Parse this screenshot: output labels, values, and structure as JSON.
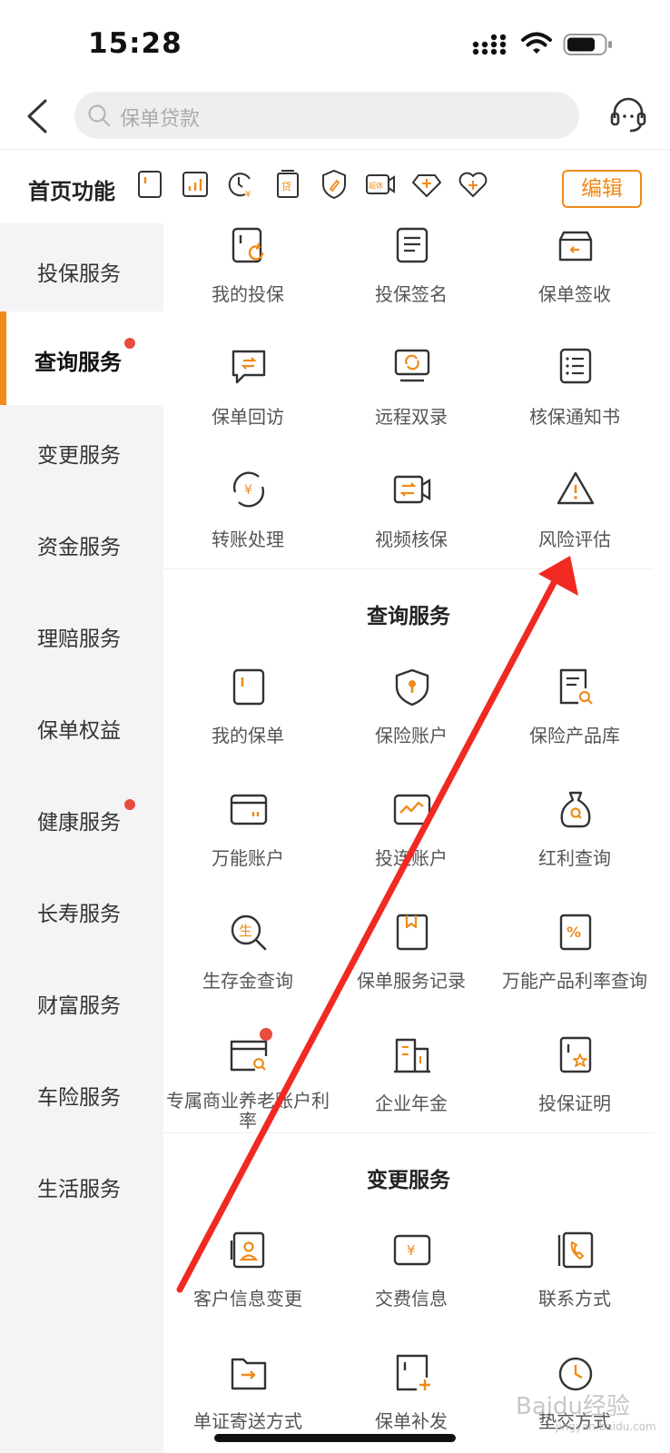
{
  "status_bar": {
    "time": "15:28"
  },
  "search": {
    "placeholder": "保单贷款"
  },
  "home_functions": {
    "title": "首页功能",
    "icons": [
      "policy-icon",
      "chart-icon",
      "clock-yuan-icon",
      "loan-doc-icon",
      "shield-pen-icon",
      "video-icon",
      "diamond-icon",
      "heart-icon"
    ],
    "loan_label": "贷",
    "video_label": "超体",
    "edit_label": "编辑"
  },
  "sidebar": {
    "items": [
      {
        "label": "投保服务",
        "active": false,
        "dot": false
      },
      {
        "label": "查询服务",
        "active": true,
        "dot": true
      },
      {
        "label": "变更服务",
        "active": false,
        "dot": false
      },
      {
        "label": "资金服务",
        "active": false,
        "dot": false
      },
      {
        "label": "理赔服务",
        "active": false,
        "dot": false
      },
      {
        "label": "保单权益",
        "active": false,
        "dot": false
      },
      {
        "label": "健康服务",
        "active": false,
        "dot": true
      },
      {
        "label": "长寿服务",
        "active": false,
        "dot": false
      },
      {
        "label": "财富服务",
        "active": false,
        "dot": false
      },
      {
        "label": "车险服务",
        "active": false,
        "dot": false
      },
      {
        "label": "生活服务",
        "active": false,
        "dot": false
      }
    ]
  },
  "sections": {
    "top_items": [
      {
        "label": "我的投保",
        "icon": "policy-refresh-icon"
      },
      {
        "label": "投保签名",
        "icon": "document-lines-icon"
      },
      {
        "label": "保单签收",
        "icon": "inbox-icon"
      },
      {
        "label": "保单回访",
        "icon": "chat-exchange-icon"
      },
      {
        "label": "远程双录",
        "icon": "monitor-sync-icon"
      },
      {
        "label": "核保通知书",
        "icon": "list-doc-icon"
      },
      {
        "label": "转账处理",
        "icon": "yuan-cycle-icon"
      },
      {
        "label": "视频核保",
        "icon": "video-exchange-icon"
      },
      {
        "label": "风险评估",
        "icon": "warning-icon"
      }
    ],
    "query": {
      "title": "查询服务",
      "items": [
        {
          "label": "我的保单",
          "icon": "policy-icon"
        },
        {
          "label": "保险账户",
          "icon": "shield-key-icon"
        },
        {
          "label": "保险产品库",
          "icon": "doc-search-icon"
        },
        {
          "label": "万能账户",
          "icon": "card-icon"
        },
        {
          "label": "投连账户",
          "icon": "chart-card-icon"
        },
        {
          "label": "红利查询",
          "icon": "money-bag-icon"
        },
        {
          "label": "生存金查询",
          "icon": "magnifier-sheng-icon"
        },
        {
          "label": "保单服务记录",
          "icon": "bookmark-doc-icon"
        },
        {
          "label": "万能产品利率查询",
          "icon": "percent-doc-icon"
        },
        {
          "label": "专属商业养老账户利率",
          "icon": "card-search-icon"
        },
        {
          "label": "企业年金",
          "icon": "building-icon"
        },
        {
          "label": "投保证明",
          "icon": "star-doc-icon"
        }
      ],
      "sheng_glyph": "生",
      "percent_glyph": "%",
      "yuan_glyph": "¥"
    },
    "change": {
      "title": "变更服务",
      "items": [
        {
          "label": "客户信息变更",
          "icon": "contact-card-icon"
        },
        {
          "label": "交费信息",
          "icon": "yuan-doc-icon"
        },
        {
          "label": "联系方式",
          "icon": "phone-book-icon"
        },
        {
          "label": "单证寄送方式",
          "icon": "folder-arrow-icon"
        },
        {
          "label": "保单补发",
          "icon": "doc-plus-icon"
        },
        {
          "label": "垫交方式",
          "icon": "clock-icon"
        }
      ]
    }
  },
  "watermark": {
    "text": "Baidu经验",
    "sub": "jingyan.baidu.com"
  },
  "colors": {
    "accent": "#f08a1a",
    "annotation_arrow": "#f02a22",
    "dot": "#e84c3d"
  }
}
